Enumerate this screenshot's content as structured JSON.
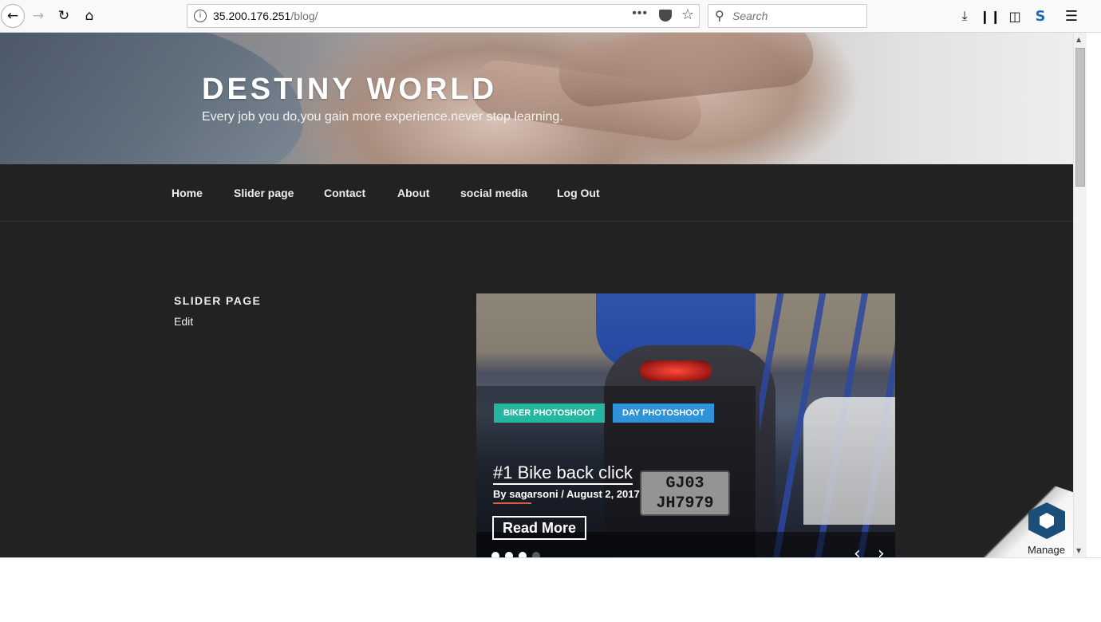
{
  "browser": {
    "url_host": "35.200.176.251",
    "url_path": "/blog/",
    "url_dots": "•••",
    "search_placeholder": "Search"
  },
  "site": {
    "title": "DESTINY WORLD",
    "tagline": "Every job you do,you gain more experience.never stop learning."
  },
  "nav": {
    "items": [
      {
        "label": "Home"
      },
      {
        "label": "Slider page"
      },
      {
        "label": "Contact"
      },
      {
        "label": "About"
      },
      {
        "label": "social media"
      },
      {
        "label": "Log Out"
      }
    ]
  },
  "widget": {
    "title": "SLIDER PAGE",
    "edit_label": "Edit"
  },
  "slider": {
    "categories": [
      {
        "label": "BIKER PHOTOSHOOT",
        "color": "#24b6a0"
      },
      {
        "label": "DAY PHOTOSHOOT",
        "color": "#2f93d9"
      }
    ],
    "post_title": "#1 Bike back click",
    "post_meta": "By sagarsoni  /  August 2, 2017",
    "read_more": "Read More",
    "plate_line1": "GJ03",
    "plate_line2": "JH7979",
    "dots_count": 4,
    "active_dots": 3
  },
  "manage": {
    "label": "Manage"
  }
}
